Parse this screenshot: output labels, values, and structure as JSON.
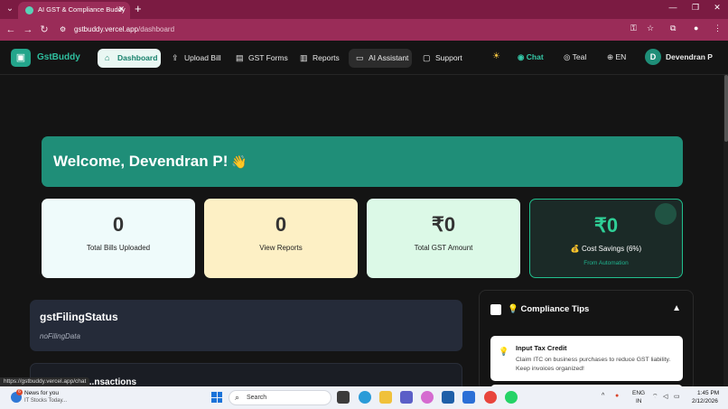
{
  "browser": {
    "tab_title": "AI GST & Compliance Buddy",
    "url_host": "gstbuddy.vercel.app",
    "url_path": "/dashboard",
    "status_url": "https://gstbuddy.vercel.app/chat"
  },
  "app": {
    "logo_text": "GstBuddy",
    "nav": [
      {
        "label": "Dashboard",
        "icon": "home-icon"
      },
      {
        "label": "Upload Bill",
        "icon": "upload-icon"
      },
      {
        "label": "GST Forms",
        "icon": "form-icon"
      },
      {
        "label": "Reports",
        "icon": "bar-chart-icon"
      },
      {
        "label": "AI Assistant",
        "icon": "message-icon"
      },
      {
        "label": "Support",
        "icon": "clipboard-icon"
      }
    ],
    "chat_label": "Chat",
    "theme_label": "Teal",
    "language_label": "EN",
    "user_initial": "D",
    "user_name": "Devendran P"
  },
  "welcome": {
    "text": "Welcome, Devendran P!",
    "emoji": "👋"
  },
  "stats": [
    {
      "value": "0",
      "label": "Total Bills Uploaded"
    },
    {
      "value": "0",
      "label": "View Reports"
    },
    {
      "value": "₹0",
      "label": "Total GST Amount"
    },
    {
      "value": "₹0",
      "label": "💰 Cost Savings (6%)",
      "sub": "From Automation"
    }
  ],
  "filing_status": {
    "title": "gstFilingStatus",
    "note": "noFilingData"
  },
  "transactions": {
    "title": "...nsactions"
  },
  "tips": {
    "title": "💡 Compliance Tips",
    "items": [
      {
        "title": "Input Tax Credit",
        "body": "Claim ITC on business purchases to reduce GST liability. Keep invoices organized!"
      }
    ]
  },
  "taskbar": {
    "news_badge": "6",
    "news_title": "News for you",
    "news_sub": "IT Stocks Today...",
    "search_placeholder": "Search",
    "lang": "ENG",
    "region": "IN",
    "time": "1:45 PM",
    "date": "2/12/2026"
  },
  "colors": {
    "accent": "#1f8e78",
    "browser_frame": "#9a2c58"
  }
}
